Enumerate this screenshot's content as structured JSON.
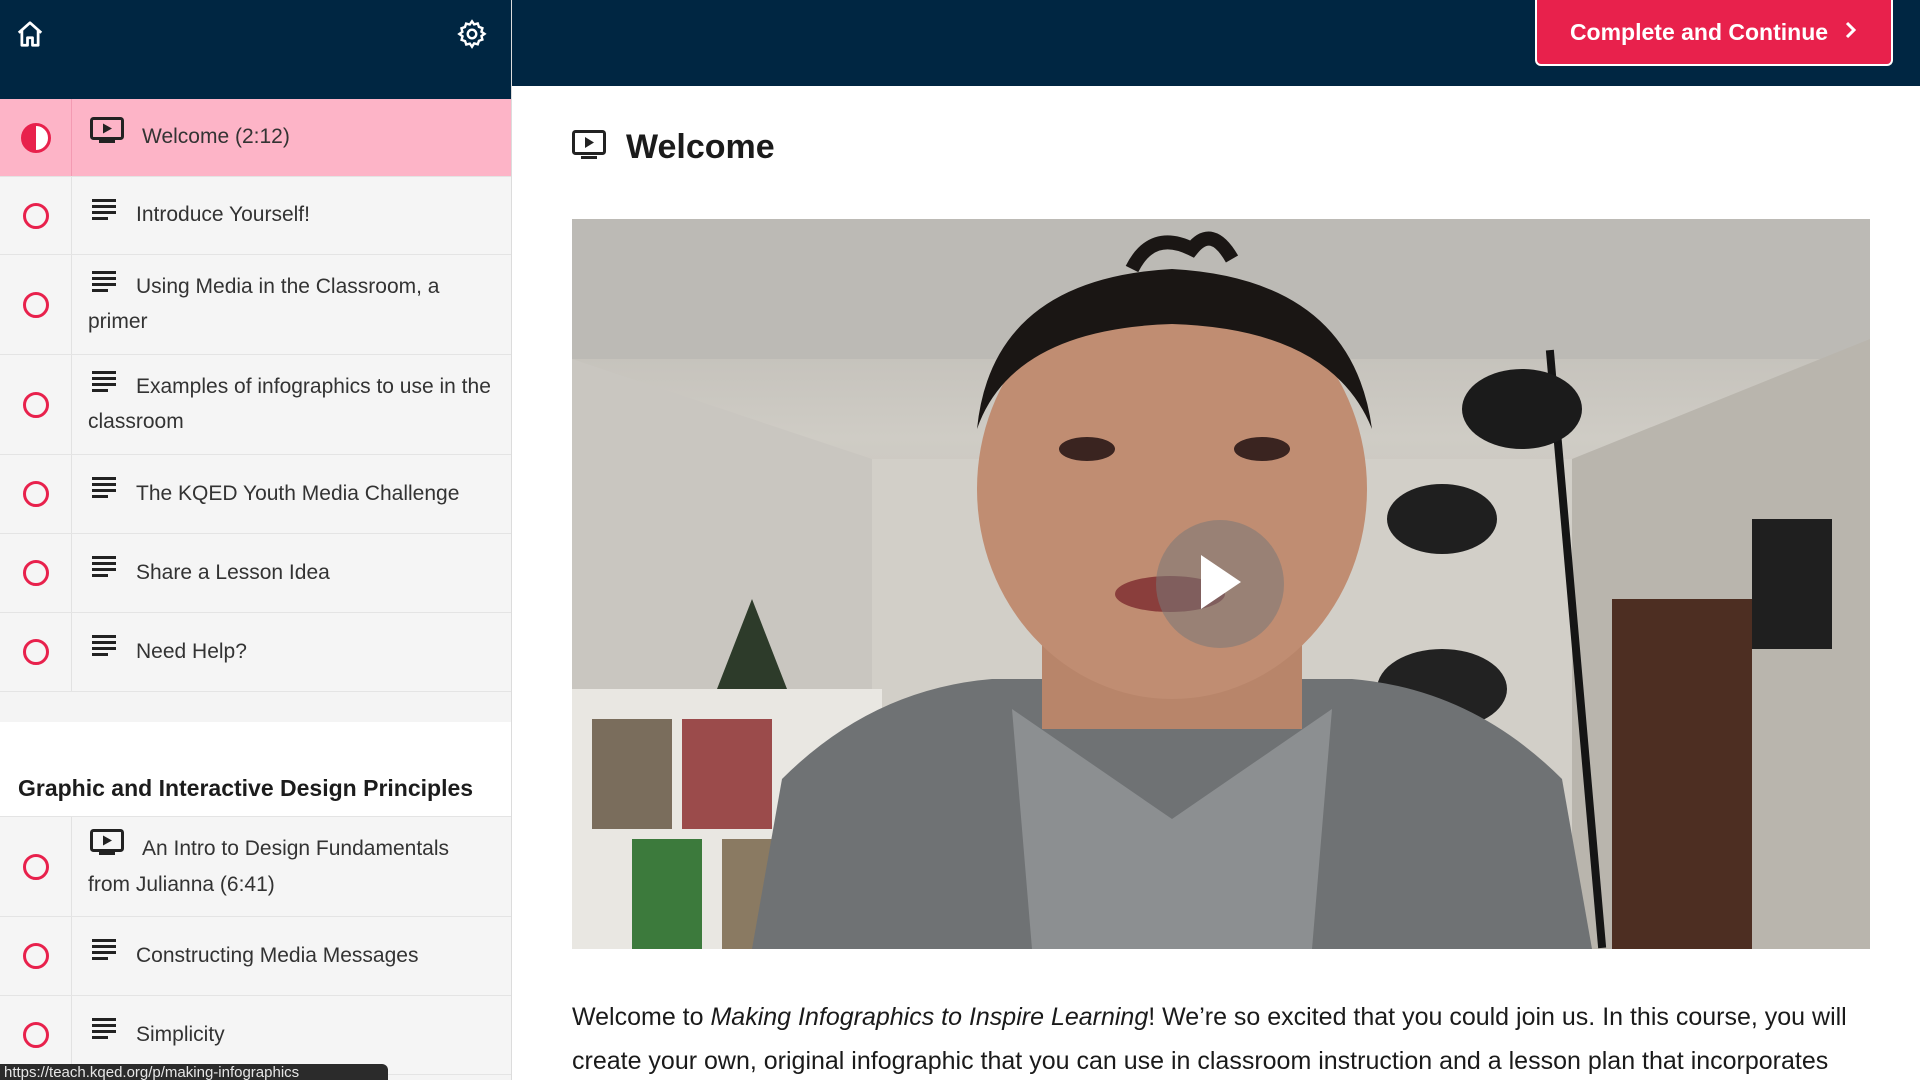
{
  "sidebar": {
    "lessons": [
      {
        "title": "Welcome (2:12)",
        "type": "video",
        "status": "in-progress"
      },
      {
        "title": "Introduce Yourself!",
        "type": "text",
        "status": "incomplete"
      },
      {
        "title": "Using Media in the Classroom, a primer",
        "type": "text",
        "status": "incomplete"
      },
      {
        "title": "Examples of infographics to use in the classroom",
        "type": "text",
        "status": "incomplete"
      },
      {
        "title": "The KQED Youth Media Challenge",
        "type": "text",
        "status": "incomplete"
      },
      {
        "title": "Share a Lesson Idea",
        "type": "text",
        "status": "incomplete"
      },
      {
        "title": "Need Help?",
        "type": "text",
        "status": "incomplete"
      }
    ],
    "section2": {
      "heading": "Graphic and Interactive Design Principles",
      "lessons": [
        {
          "title": "An Intro to Design Fundamentals from Julianna (6:41)",
          "type": "video",
          "status": "incomplete"
        },
        {
          "title": "Constructing Media Messages",
          "type": "text",
          "status": "incomplete"
        },
        {
          "title": "Simplicity",
          "type": "text",
          "status": "incomplete"
        }
      ]
    },
    "status_url": "https://teach.kqed.org/p/making-infographics"
  },
  "header": {
    "complete_label": "Complete and Continue"
  },
  "main": {
    "title": "Welcome",
    "body_prefix": "Welcome to ",
    "body_course": "Making Infographics to Inspire Learning",
    "body_rest": "! We’re so excited that you could join us. In this course, you will create your own, original infographic that you can use in classroom instruction and a lesson plan that incorporates"
  },
  "colors": {
    "navy": "#002642",
    "accent": "#e8214c",
    "active_row": "#fdb4c7"
  },
  "icons": [
    "home-icon",
    "gear-icon",
    "video-lesson-icon",
    "text-lesson-icon",
    "play-icon",
    "chevron-right-icon"
  ]
}
